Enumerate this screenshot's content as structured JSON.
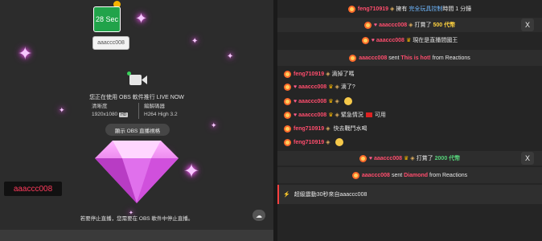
{
  "stream": {
    "timer": "28 Sec",
    "host_tag": "aaaccc008",
    "live_status": "您正在使用 OBS 軟件推行 LIVE NOW",
    "resolution_label": "清晰度",
    "resolution_value": "1920x1080",
    "resolution_badge": "HD",
    "encoder_label": "編解碼器",
    "encoder_value": "H264 High 3.2",
    "obs_button": "顯示 OBS 直播視格",
    "overlay_username": "aaaccc008",
    "stop_hint": "若要停止直播，您需要在 OBS 軟件中停止直播。",
    "cloud_icon": "cloud-icon"
  },
  "chat": {
    "messages": [
      {
        "user": "feng710919",
        "pre": "擁有",
        "highlight": "完全玩具控制",
        "post": "時間 1 分鐘"
      },
      {
        "user": "aaaccc008",
        "pre": "打賞了",
        "amount": "500 代幣"
      },
      {
        "user": "aaaccc008",
        "text": "現在是直播間國王"
      },
      {
        "user": "aaaccc008",
        "pre": "sent",
        "highlight": "This is hot!",
        "post": "from Reactions"
      },
      {
        "user": "feng710919",
        "text": "滴掉了嗎"
      },
      {
        "user": "aaaccc008",
        "text": "滴了?"
      },
      {
        "user": "aaaccc008",
        "text": ""
      },
      {
        "user": "aaaccc008",
        "text": "緊急情況",
        "extra": "可用"
      },
      {
        "user": "feng710919",
        "text": "快去戰鬥水喝"
      },
      {
        "user": "feng710919",
        "text": ""
      },
      {
        "user": "aaaccc008",
        "pre": "打賞了",
        "amount": "2000 代幣"
      },
      {
        "user": "aaaccc008",
        "pre": "sent",
        "highlight": "Diamond",
        "post": "from Reactions"
      }
    ],
    "notice": "超級震動30秒來自aaaccc008",
    "close_icon": "X"
  }
}
